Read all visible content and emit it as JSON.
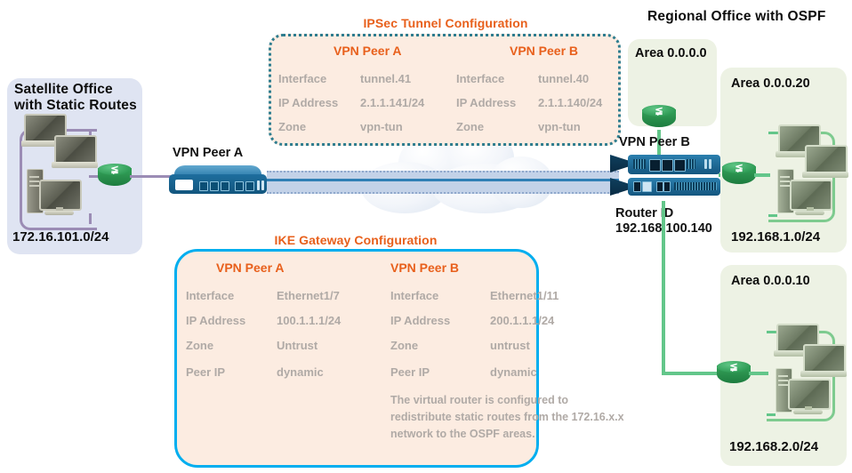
{
  "diagram": {
    "headings": {
      "satellite_office": "Satellite Office\nwith Static Routes",
      "regional_office": "Regional Office  with OSPF",
      "ipsec_title": "IPSec Tunnel Configuration",
      "ike_title": "IKE Gateway Configuration"
    },
    "colors": {
      "accent_orange": "#E8601C",
      "ike_border_blue": "#00AEEF",
      "ipsec_border_teal": "#2e7d8f",
      "config_fill_peach": "#fcece1",
      "satellite_fill": "#dfe4f2",
      "ospf_area_fill": "#edf2e4",
      "router_green": "#2f9c56",
      "link_green": "#63c68a",
      "link_purple": "#9b8cb5",
      "tunnel_band": "#c3d2e8",
      "tunnel_line": "#2f7fb5",
      "config_text_gray": "#b0aaa6"
    },
    "satellite": {
      "subnet": "172.16.101.0/24",
      "router_icon": "router-icon"
    },
    "devices": {
      "vpn_peer_a": "VPN Peer A",
      "vpn_peer_b": "VPN Peer B",
      "router_id_label": "Router ID\n192.168.100.140"
    },
    "ospf_areas": [
      {
        "name": "Area 0.0.0.0",
        "subnet": ""
      },
      {
        "name": "Area 0.0.0.20",
        "subnet": "192.168.1.0/24"
      },
      {
        "name": "Area 0.0.0.10",
        "subnet": "192.168.2.0/24"
      }
    ],
    "ipsec_config": {
      "title": "IPSec Tunnel Configuration",
      "peer_a": {
        "title": "VPN Peer A",
        "rows": [
          {
            "key": "Interface",
            "value": "tunnel.41"
          },
          {
            "key": "IP Address",
            "value": "2.1.1.141/24"
          },
          {
            "key": "Zone",
            "value": "vpn-tun"
          }
        ]
      },
      "peer_b": {
        "title": "VPN Peer B",
        "rows": [
          {
            "key": "Interface",
            "value": "tunnel.40"
          },
          {
            "key": "IP Address",
            "value": "2.1.1.140/24"
          },
          {
            "key": "Zone",
            "value": "vpn-tun"
          }
        ]
      }
    },
    "ike_config": {
      "title": "IKE Gateway Configuration",
      "peer_a": {
        "title": "VPN Peer A",
        "rows": [
          {
            "key": "Interface",
            "value": "Ethernet1/7"
          },
          {
            "key": "IP Address",
            "value": "100.1.1.1/24"
          },
          {
            "key": "Zone",
            "value": "Untrust"
          },
          {
            "key": "Peer IP",
            "value": "dynamic"
          }
        ]
      },
      "peer_b": {
        "title": "VPN Peer B",
        "rows": [
          {
            "key": "Interface",
            "value": "Ethernet1/11"
          },
          {
            "key": "IP Address",
            "value": "200.1.1.1/24"
          },
          {
            "key": "Zone",
            "value": "untrust"
          },
          {
            "key": "Peer IP",
            "value": "dynamic"
          }
        ],
        "note": "The virtual router is configured to\nredistribute static routes from the 172.16.x.x\nnetwork to the OSPF areas."
      }
    }
  }
}
